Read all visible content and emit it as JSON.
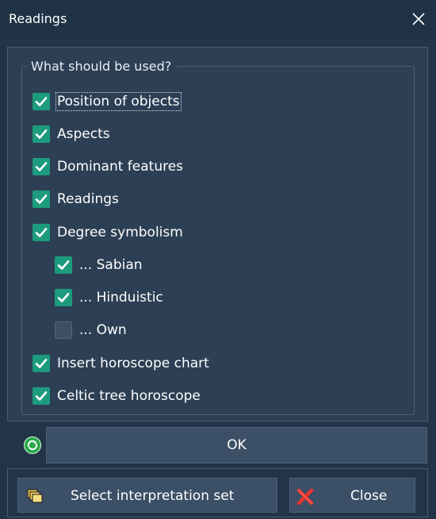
{
  "window": {
    "title": "Readings"
  },
  "group": {
    "legend": "What should be used?",
    "options": [
      {
        "label": "Position of objects",
        "checked": true
      },
      {
        "label": "Aspects",
        "checked": true
      },
      {
        "label": "Dominant features",
        "checked": true
      },
      {
        "label": "Readings",
        "checked": true
      },
      {
        "label": "Degree symbolism",
        "checked": true
      },
      {
        "label": "... Sabian",
        "checked": true
      },
      {
        "label": "... Hinduistic",
        "checked": true
      },
      {
        "label": "... Own",
        "checked": false
      },
      {
        "label": "Insert horoscope chart",
        "checked": true
      },
      {
        "label": "Celtic tree horoscope",
        "checked": true
      }
    ]
  },
  "buttons": {
    "ok": "OK",
    "select_set": "Select interpretation set",
    "close": "Close"
  },
  "icons": {
    "ok": "green-refresh-icon",
    "select_set": "folders-icon",
    "close": "red-x-icon",
    "checkbox": "checkmark-icon"
  },
  "colors": {
    "background": "#223449",
    "checkbox_checked": "#1d9b7e",
    "button": "#3b4f66"
  }
}
